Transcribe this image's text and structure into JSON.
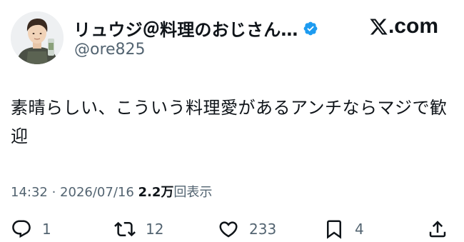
{
  "user": {
    "display_name": "リュウジ＠料理のおじさん…",
    "handle": "@ore825"
  },
  "brand": {
    "label": ".com",
    "logo_icon": "x-logo-icon"
  },
  "tweet": {
    "text": "素晴らしい、こういう料理愛があるアンチならマジで歓迎",
    "time": "14:32",
    "separator": " · ",
    "date": "2026/07/16",
    "views_count": "2.2万",
    "views_label": "回表示"
  },
  "actions": {
    "reply_count": "1",
    "retweet_count": "12",
    "like_count": "233",
    "bookmark_count": "4"
  },
  "colors": {
    "text": "#0f1419",
    "secondary": "#536471",
    "verified": "#1d9bf0"
  },
  "icons": [
    "verified-badge-icon",
    "x-logo-icon",
    "reply-icon",
    "retweet-icon",
    "like-icon",
    "bookmark-icon",
    "share-icon"
  ]
}
